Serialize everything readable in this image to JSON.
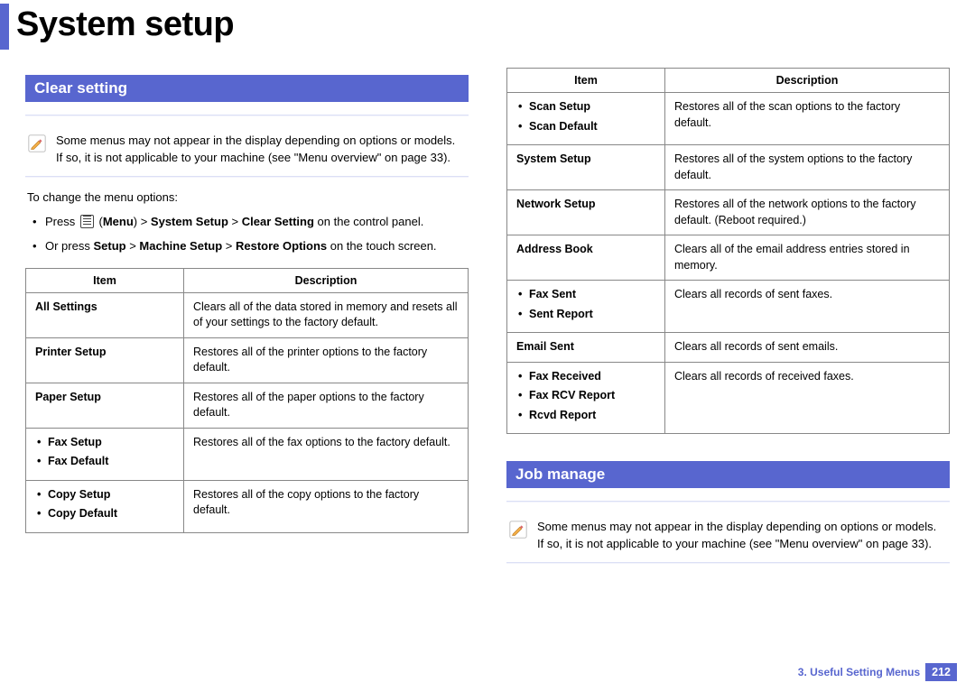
{
  "title": "System setup",
  "footer": {
    "chapter": "3.  Useful Setting Menus",
    "page": "212"
  },
  "left": {
    "section_heading": "Clear setting",
    "note": "Some menus may not appear in the display depending on options or models. If so, it is not applicable to your machine (see \"Menu overview\" on page 33).",
    "intro": "To change the menu options:",
    "step1_prefix": "Press ",
    "step1_mid": "(",
    "step1_menu_bold": "Menu",
    "step1_after_menu": ") > ",
    "step1_system": "System Setup",
    "step1_gt2": " > ",
    "step1_clear": "Clear Setting",
    "step1_suffix": " on the control panel.",
    "step2_prefix": "Or press ",
    "step2_setup": "Setup",
    "step2_gt1": " > ",
    "step2_machine": "Machine Setup",
    "step2_gt2": " > ",
    "step2_restore": "Restore Options",
    "step2_suffix": " on the touch screen.",
    "table": {
      "hdr_item": "Item",
      "hdr_desc": "Description",
      "rows": [
        {
          "item_single": "All Settings",
          "desc": "Clears all of the data stored in memory and resets all of your settings to the factory default."
        },
        {
          "item_single": "Printer Setup",
          "desc": "Restores all of the printer options to the factory default."
        },
        {
          "item_single": "Paper Setup",
          "desc": "Restores all of the paper options to the factory default."
        },
        {
          "item_list": [
            "Fax Setup",
            "Fax Default"
          ],
          "desc": "Restores all of the fax options to the factory default."
        },
        {
          "item_list": [
            "Copy Setup",
            "Copy Default"
          ],
          "desc": "Restores all of the copy options to the factory default."
        }
      ]
    }
  },
  "right": {
    "table": {
      "hdr_item": "Item",
      "hdr_desc": "Description",
      "rows": [
        {
          "item_list": [
            "Scan Setup",
            "Scan Default"
          ],
          "desc": "Restores all of the scan options to the factory default."
        },
        {
          "item_single": "System Setup",
          "desc": "Restores all of the system options to the factory default."
        },
        {
          "item_single": "Network Setup",
          "desc": "Restores all of the network options to the factory default. (Reboot required.)"
        },
        {
          "item_single": "Address Book",
          "desc": "Clears all of the email address entries stored in memory."
        },
        {
          "item_list": [
            "Fax Sent",
            "Sent Report"
          ],
          "desc": "Clears all records of sent faxes."
        },
        {
          "item_single": "Email Sent",
          "desc": "Clears all records of sent emails."
        },
        {
          "item_list": [
            "Fax Received",
            "Fax RCV Report",
            "Rcvd Report"
          ],
          "desc": "Clears all records of received faxes."
        }
      ]
    },
    "section_heading": "Job manage",
    "note": "Some menus may not appear in the display depending on options or models. If so, it is not applicable to your machine (see \"Menu overview\" on page 33)."
  }
}
